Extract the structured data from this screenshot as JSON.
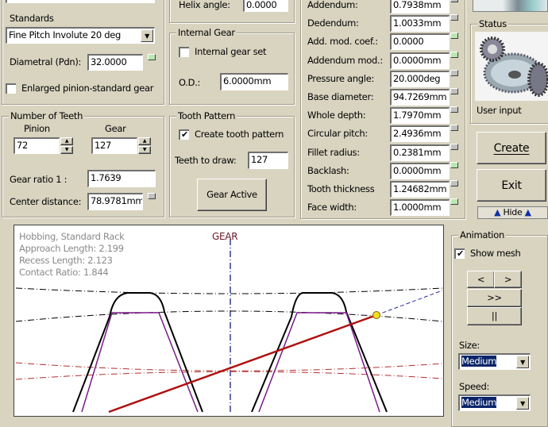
{
  "left": {
    "standards_label": "Standards",
    "standards_value": "Fine Pitch Involute 20 deg",
    "diametral_label": "Diametral (Pdn):",
    "diametral_value": "32.0000",
    "enlarged_label": "Enlarged pinion-standard gear",
    "enlarged_checked": false,
    "teeth_group": "Number of Teeth",
    "pinion_label": "Pinion",
    "pinion_value": "72",
    "gear_label": "Gear",
    "gear_value": "127",
    "ratio_label": "Gear ratio 1 :",
    "ratio_value": "1.7639",
    "center_label": "Center distance:",
    "center_value": "78.9781mm"
  },
  "middle": {
    "helix_label": "Helix angle:",
    "helix_value": "0.0000",
    "internal_group": "Internal Gear",
    "internal_label": "Internal gear set",
    "internal_checked": false,
    "od_label": "O.D.:",
    "od_value": "6.0000mm",
    "pattern_group": "Tooth Pattern",
    "create_pattern_label": "Create tooth pattern",
    "create_pattern_checked": true,
    "teeth_draw_label": "Teeth to draw:",
    "teeth_draw_value": "127",
    "gear_active_label": "Gear Active"
  },
  "params": [
    {
      "label": "Addendum:",
      "value": "0.7938mm",
      "lock": "gray"
    },
    {
      "label": "Dedendum:",
      "value": "1.0033mm",
      "lock": "gray"
    },
    {
      "label": "Add. mod. coef.:",
      "value": "0.0000",
      "lock": "green"
    },
    {
      "label": "Addendum mod.:",
      "value": "0.0000mm",
      "lock": "green"
    },
    {
      "label": "Pressure angle:",
      "value": "20.000deg",
      "lock": "gray"
    },
    {
      "label": "Base diameter:",
      "value": "94.7269mm",
      "lock": "gray"
    },
    {
      "label": "Whole depth:",
      "value": "1.7970mm",
      "lock": "gray"
    },
    {
      "label": "Circular pitch:",
      "value": "2.4936mm",
      "lock": "gray"
    },
    {
      "label": "Fillet radius:",
      "value": "0.2381mm",
      "lock": "gray"
    },
    {
      "label": "Backlash:",
      "value": "0.0000mm",
      "lock": "green"
    },
    {
      "label": "Tooth thickness",
      "value": "1.24682mm",
      "lock": "gray"
    },
    {
      "label": "Face width:",
      "value": "1.0000mm",
      "lock": "green"
    }
  ],
  "right": {
    "status_group": "Status",
    "status_text": "User input",
    "create_label": "Create",
    "exit_label": "Exit",
    "hide_label": "Hide"
  },
  "canvas": {
    "info": [
      "Hobbing, Standard Rack",
      "Approach Length: 2.199",
      "Recess Length: 2.123",
      "Contact Ratio: 1.844"
    ],
    "gear_label": "GEAR"
  },
  "animation": {
    "group": "Animation",
    "show_mesh_label": "Show mesh",
    "show_mesh_checked": true,
    "prev_label": "<",
    "next_label": ">",
    "play_label": ">>",
    "pause_label": "||",
    "size_label": "Size:",
    "size_value": "Medium",
    "speed_label": "Speed:",
    "speed_value": "Medium"
  },
  "colors": {
    "green_lock": "#b8e8b0",
    "gray_lock": "#c0c0c0",
    "highlight": "#0a246a",
    "line_of_action": "#b01010"
  }
}
